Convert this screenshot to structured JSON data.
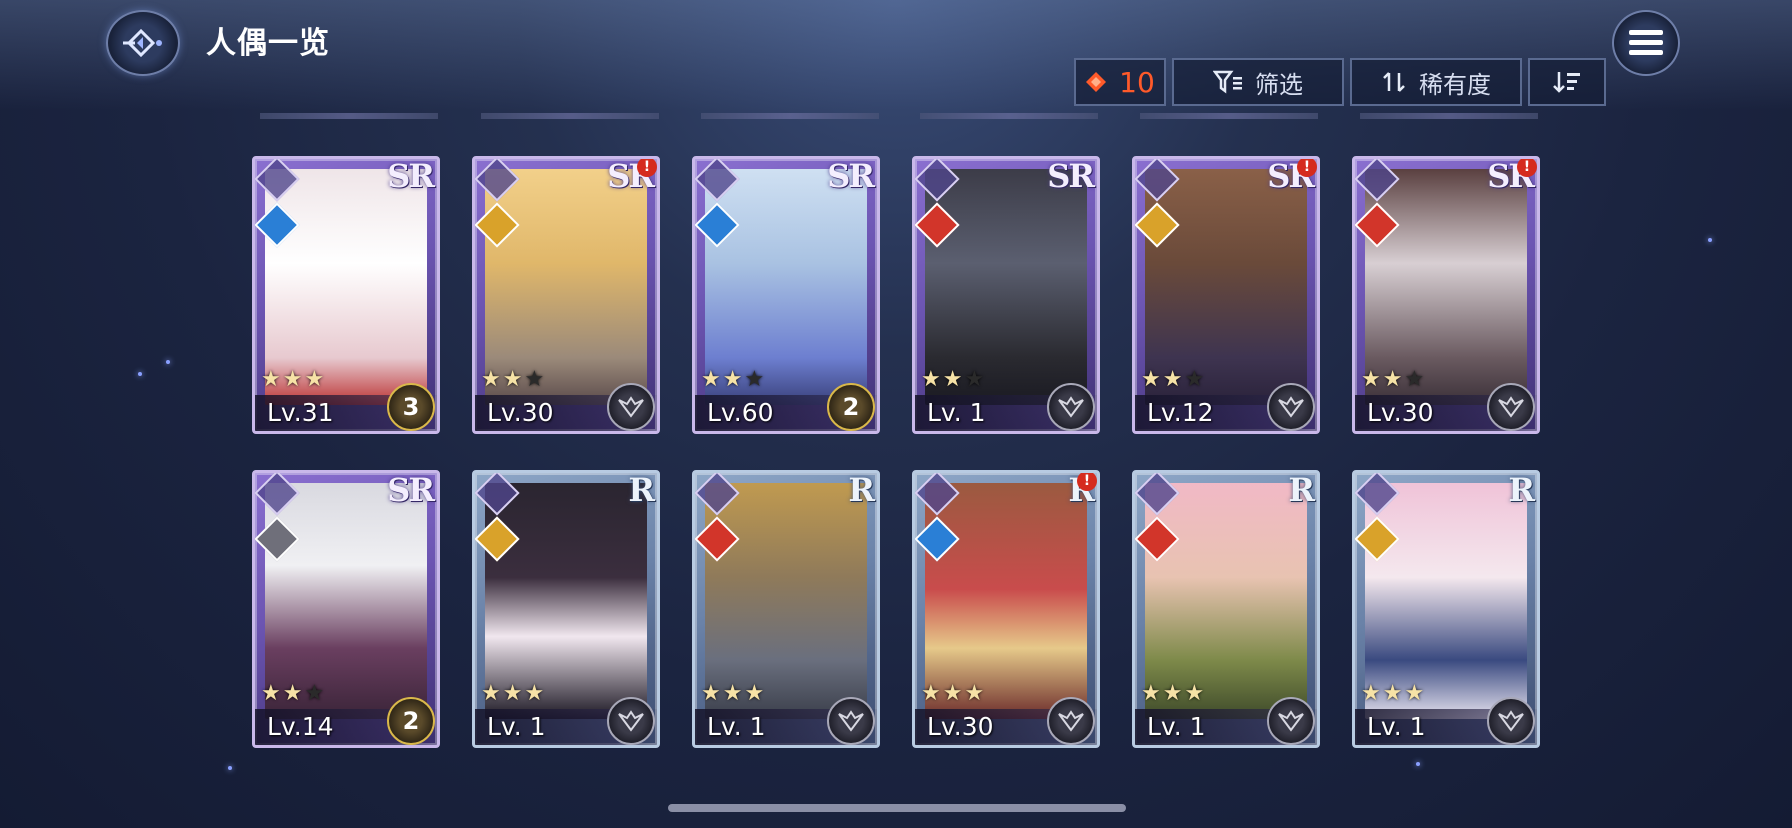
{
  "header": {
    "title": "人偶一览",
    "back_icon": "back-arrow-icon",
    "menu_icon": "hamburger-menu-icon"
  },
  "toolbar": {
    "currency_value": "10",
    "currency_icon": "diamond-gem-icon",
    "filter_label": "筛选",
    "filter_icon": "filter-icon",
    "sort_label": "稀有度",
    "sort_icon": "sort-arrows-icon",
    "order_icon": "sort-descending-icon"
  },
  "colors": {
    "currency": "#ff5a2a",
    "sr_card": "#7a63c4",
    "r_card": "#7d96ba",
    "alert": "#d52b1e"
  },
  "cards": [
    {
      "rarity": "SR",
      "element": "water",
      "stars": 3,
      "max_stars": 3,
      "level": "Lv.31",
      "badge": "3",
      "alert": false
    },
    {
      "rarity": "SR",
      "element": "light",
      "stars": 2,
      "max_stars": 3,
      "level": "Lv.30",
      "badge": "",
      "alert": true
    },
    {
      "rarity": "SR",
      "element": "water",
      "stars": 2,
      "max_stars": 3,
      "level": "Lv.60",
      "badge": "2",
      "alert": false
    },
    {
      "rarity": "SR",
      "element": "fire",
      "stars": 2,
      "max_stars": 3,
      "level": "Lv. 1",
      "badge": "",
      "alert": false
    },
    {
      "rarity": "SR",
      "element": "light",
      "stars": 2,
      "max_stars": 3,
      "level": "Lv.12",
      "badge": "",
      "alert": true
    },
    {
      "rarity": "SR",
      "element": "fire",
      "stars": 2,
      "max_stars": 3,
      "level": "Lv.30",
      "badge": "",
      "alert": true
    },
    {
      "rarity": "SR",
      "element": "dark",
      "stars": 2,
      "max_stars": 3,
      "level": "Lv.14",
      "badge": "2",
      "alert": false
    },
    {
      "rarity": "R",
      "element": "light",
      "stars": 3,
      "max_stars": 3,
      "level": "Lv. 1",
      "badge": "",
      "alert": false
    },
    {
      "rarity": "R",
      "element": "fire",
      "stars": 3,
      "max_stars": 3,
      "level": "Lv. 1",
      "badge": "",
      "alert": false
    },
    {
      "rarity": "R",
      "element": "water",
      "stars": 3,
      "max_stars": 3,
      "level": "Lv.30",
      "badge": "",
      "alert": true
    },
    {
      "rarity": "R",
      "element": "fire",
      "stars": 3,
      "max_stars": 3,
      "level": "Lv. 1",
      "badge": "",
      "alert": false
    },
    {
      "rarity": "R",
      "element": "light",
      "stars": 3,
      "max_stars": 3,
      "level": "Lv. 1",
      "badge": "",
      "alert": false
    }
  ]
}
